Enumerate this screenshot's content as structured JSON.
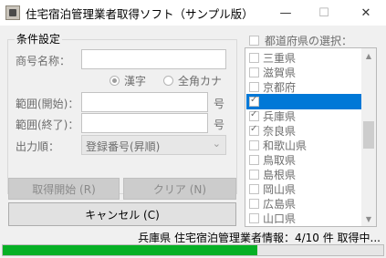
{
  "window": {
    "title": "住宅宿泊管理業者取得ソフト（サンプル版）",
    "minimize_glyph": "—",
    "maximize_glyph": "☐",
    "close_glyph": "✕"
  },
  "conditions": {
    "group_title": "条件設定",
    "trade_name_label": "商号名称：",
    "trade_name_value": "",
    "radio_kanji": "漢字",
    "radio_kana": "全角カナ",
    "kanji_selected": true,
    "range_start_label": "範囲(開始)：",
    "range_end_label": "範囲(終了)：",
    "range_start_value": "",
    "range_end_value": "",
    "unit_label": "号",
    "output_order_label": "出力順：",
    "output_order_value": "登録番号(昇順)"
  },
  "buttons": {
    "start": "取得開始 (R)",
    "clear": "クリア (N)",
    "cancel": "キャンセル (C)"
  },
  "prefectures": {
    "select_all_label": "都道府県の選択：",
    "select_all_checked": false,
    "items": [
      {
        "name": "三重県",
        "checked": false,
        "selected": false
      },
      {
        "name": "滋賀県",
        "checked": false,
        "selected": false
      },
      {
        "name": "京都府",
        "checked": false,
        "selected": false
      },
      {
        "name": "",
        "checked": true,
        "selected": true
      },
      {
        "name": "兵庫県",
        "checked": true,
        "selected": false
      },
      {
        "name": "奈良県",
        "checked": true,
        "selected": false
      },
      {
        "name": "和歌山県",
        "checked": false,
        "selected": false
      },
      {
        "name": "鳥取県",
        "checked": false,
        "selected": false
      },
      {
        "name": "島根県",
        "checked": false,
        "selected": false
      },
      {
        "name": "岡山県",
        "checked": false,
        "selected": false
      },
      {
        "name": "広島県",
        "checked": false,
        "selected": false
      },
      {
        "name": "山口県",
        "checked": false,
        "selected": false
      }
    ]
  },
  "status": {
    "text": "兵庫県 住宅宿泊管理業者情報：4/10 件 取得中...",
    "progress_percent": 67,
    "progress_color": "#06b025"
  },
  "colors": {
    "selection": "#0078d7",
    "window_bg": "#f0f0f0"
  }
}
